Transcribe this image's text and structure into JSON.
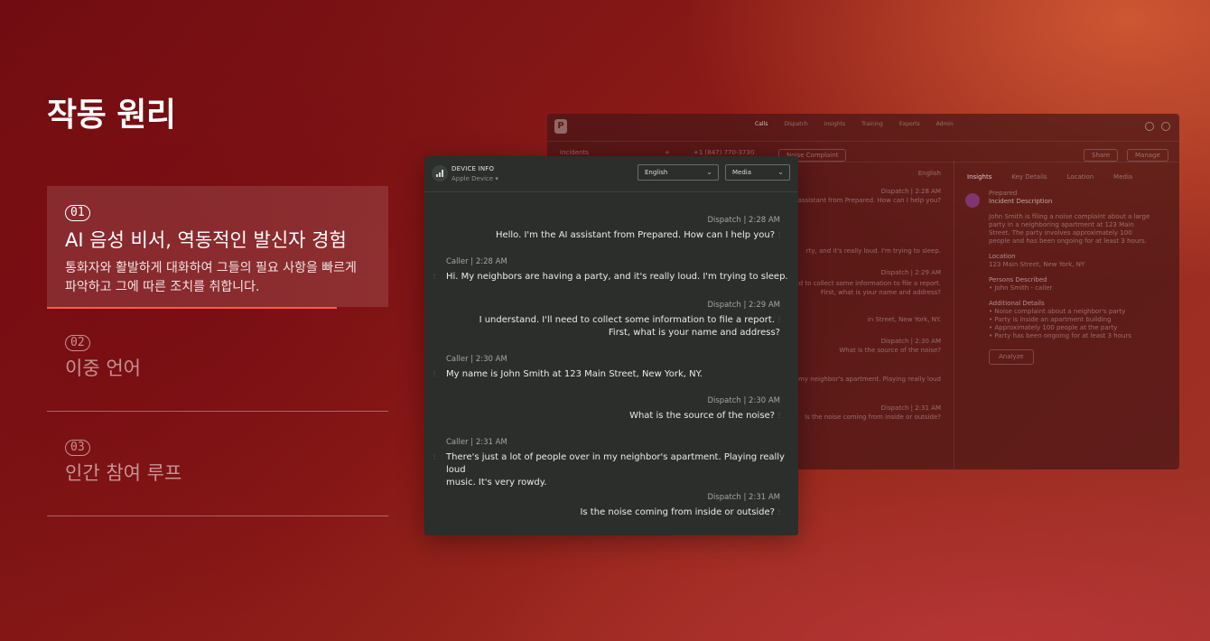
{
  "heading": "작동 원리",
  "steps": [
    {
      "num": "01",
      "title": "AI 음성 비서, 역동적인 발신자 경험",
      "desc": "통화자와 활발하게 대화하여 그들의 필요 사항을 빠르게 파악하고 그에 따른 조치를 취합니다.",
      "progress": 0.85
    },
    {
      "num": "02",
      "title": "이중 언어"
    },
    {
      "num": "03",
      "title": "인간 참여 루프"
    }
  ],
  "colors": {
    "accent": "#ff5a4a",
    "panel_bg": "#2b2e2b"
  },
  "background_app": {
    "logo": "P",
    "nav": [
      "Calls",
      "Dispatch",
      "Insights",
      "Training",
      "Exports",
      "Admin"
    ],
    "incidents_label": "Incidents",
    "phone": "+1 (847) 770-3730",
    "tag": "Noise Complaint",
    "share_label": "Share",
    "manage_label": "Manage",
    "language_select": "English",
    "media_select": "Media",
    "tabs": [
      "Insights",
      "Key Details",
      "Location",
      "Media"
    ],
    "card_name": "Prepared",
    "card_title": "Incident Description",
    "card_desc": "John Smith is filing a noise complaint about a large party in a neighboring apartment at 123 Main Street. The party involves approximately 100 people and has been ongoing for at least 3 hours.",
    "location_label": "Location",
    "location_value": "123 Main Street, New York, NY",
    "persons_label": "Persons Described",
    "persons_value": "• John Smith - caller",
    "details_label": "Additional Details",
    "details": [
      "• Noise complaint about a neighbor's party",
      "• Party is inside an apartment building",
      "• Approximately 100 people at the party",
      "• Party has been ongoing for at least 3 hours"
    ],
    "analyze_label": "Analyze",
    "mid_lines": [
      "Dispatch | 2:28 AM",
      "assistant from Prepared. How can I help you?",
      "rty, and it's really loud. I'm trying to sleep.",
      "Dispatch | 2:29 AM",
      "eed to collect some information to file a report.",
      "First, what is your name and address?",
      "in Street, New York, NY.",
      "Dispatch | 2:30 AM",
      "What is the source of the noise?",
      "n my neighbor's apartment. Playing really loud",
      "Dispatch | 2:31 AM",
      "Is the noise coming from inside or outside?"
    ]
  },
  "panel": {
    "device_title": "DEVICE INFO",
    "device_sub": "Apple Device",
    "language": "English",
    "media": "Media",
    "messages": [
      {
        "side": "right",
        "speaker": "Dispatch",
        "time": "2:28 AM",
        "lines": [
          "Hello. I'm the AI assistant from Prepared. How can I help you?"
        ]
      },
      {
        "side": "left",
        "speaker": "Caller",
        "time": "2:28 AM",
        "lines": [
          "Hi. My neighbors are having a party, and it's really loud. I'm trying to sleep."
        ]
      },
      {
        "side": "right",
        "speaker": "Dispatch",
        "time": "2:29 AM",
        "lines": [
          "I understand. I'll need to collect some information to file a report.",
          "First, what is your name and address?"
        ]
      },
      {
        "side": "left",
        "speaker": "Caller",
        "time": "2:30 AM",
        "lines": [
          "My name is John Smith at 123 Main Street, New York, NY."
        ]
      },
      {
        "side": "right",
        "speaker": "Dispatch",
        "time": "2:30 AM",
        "lines": [
          "What is the source of the noise?"
        ]
      },
      {
        "side": "left",
        "speaker": "Caller",
        "time": "2:31 AM",
        "lines": [
          "There's just a lot of people over in my neighbor's apartment. Playing really loud",
          "music. It's very rowdy."
        ]
      },
      {
        "side": "right",
        "speaker": "Dispatch",
        "time": "2:31 AM",
        "lines": [
          "Is the noise coming from inside or outside?"
        ]
      }
    ]
  }
}
